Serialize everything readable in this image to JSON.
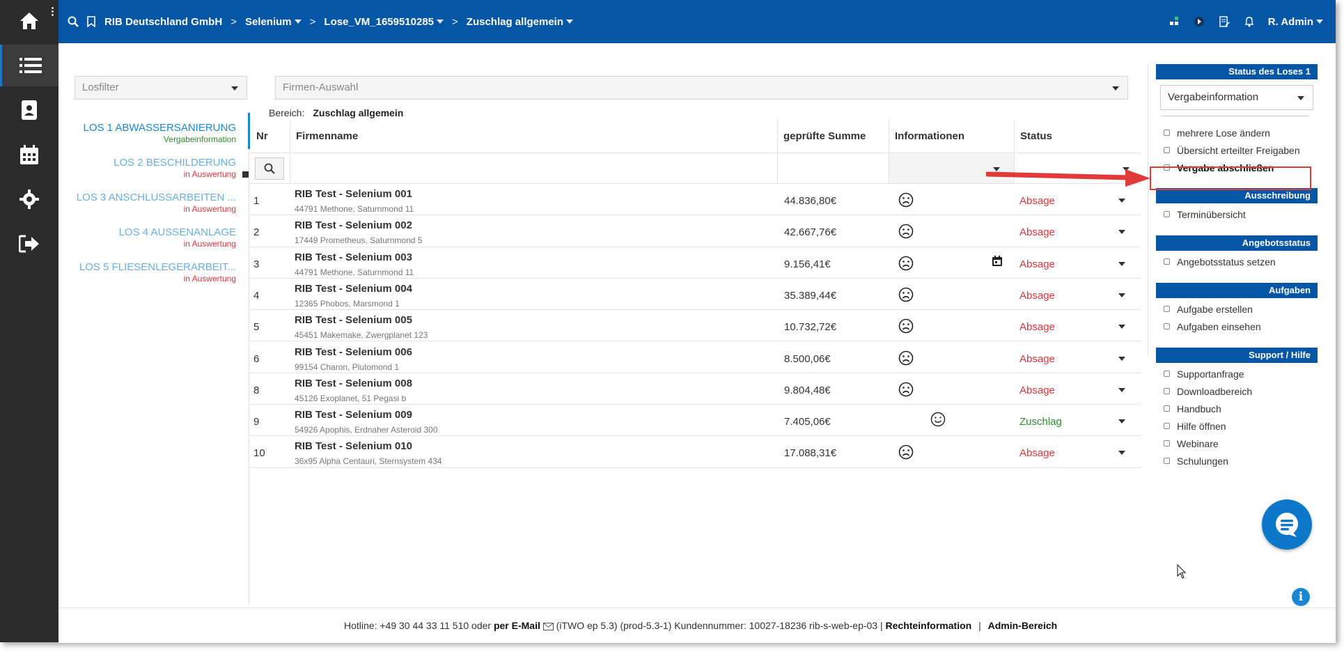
{
  "topbar": {
    "breadcrumbs": [
      {
        "label": "RIB Deutschland GmbH",
        "dropdown": false
      },
      {
        "label": "Selenium",
        "dropdown": true
      },
      {
        "label": "Lose_VM_1659510285",
        "dropdown": true
      },
      {
        "label": "Zuschlag allgemein",
        "dropdown": true
      }
    ],
    "user": "R. Admin"
  },
  "filters": {
    "losfilter_placeholder": "Losfilter",
    "firmen_placeholder": "Firmen-Auswahl",
    "bereich_label": "Bereich:",
    "bereich_value": "Zuschlag allgemein"
  },
  "lose": [
    {
      "name": "LOS 1 ABWASSERSANIERUNG",
      "status": "Vergabeinformation",
      "status_color": "green",
      "active": true
    },
    {
      "name": "LOS 2 BESCHILDERUNG",
      "status": "in Auswertung",
      "status_color": "red",
      "active": false
    },
    {
      "name": "LOS 3 ANSCHLUSSARBEITEN ...",
      "status": "in Auswertung",
      "status_color": "red",
      "active": false
    },
    {
      "name": "LOS 4 AUSSENANLAGE",
      "status": "in Auswertung",
      "status_color": "red",
      "active": false
    },
    {
      "name": "LOS 5 FLIESENLEGERARBEIT...",
      "status": "in Auswertung",
      "status_color": "red",
      "active": false
    }
  ],
  "table": {
    "headers": {
      "nr": "Nr",
      "firma": "Firmenname",
      "summe": "geprüfte Summe",
      "info": "Informationen",
      "status": "Status"
    },
    "rows": [
      {
        "nr": "1",
        "firma": "RIB Test - Selenium 001",
        "adresse": "44791 Methone, Saturnmond 11",
        "summe": "44.836,80€",
        "face": "sad",
        "calendar": false,
        "status": "Absage"
      },
      {
        "nr": "2",
        "firma": "RIB Test - Selenium 002",
        "adresse": "17449 Prometheus, Saturnmond 5",
        "summe": "42.667,76€",
        "face": "sad",
        "calendar": false,
        "status": "Absage"
      },
      {
        "nr": "3",
        "firma": "RIB Test - Selenium 003",
        "adresse": "44791 Methone, Saturnmond 11",
        "summe": "9.156,41€",
        "face": "sad",
        "calendar": true,
        "status": "Absage"
      },
      {
        "nr": "4",
        "firma": "RIB Test - Selenium 004",
        "adresse": "12365 Phobos, Marsmond 1",
        "summe": "35.389,44€",
        "face": "sad",
        "calendar": false,
        "status": "Absage"
      },
      {
        "nr": "5",
        "firma": "RIB Test - Selenium 005",
        "adresse": "45451 Makemake, Zwergplanet 123",
        "summe": "10.732,72€",
        "face": "sad",
        "calendar": false,
        "status": "Absage"
      },
      {
        "nr": "6",
        "firma": "RIB Test - Selenium 006",
        "adresse": "99154 Charon, Plutomond 1",
        "summe": "8.500,06€",
        "face": "sad",
        "calendar": false,
        "status": "Absage"
      },
      {
        "nr": "8",
        "firma": "RIB Test - Selenium 008",
        "adresse": "45126 Exoplanet, 51 Pegasi b",
        "summe": "9.804,48€",
        "face": "sad",
        "calendar": false,
        "status": "Absage"
      },
      {
        "nr": "9",
        "firma": "RIB Test - Selenium 009",
        "adresse": "54926 Apophis, Erdnaher Asteroid 300",
        "summe": "7.405,06€",
        "face": "happy",
        "calendar": false,
        "status": "Zuschlag"
      },
      {
        "nr": "10",
        "firma": "RIB Test - Selenium 010",
        "adresse": "36x95 Alpha Centauri, Sternsystem 434",
        "summe": "17.088,31€",
        "face": "sad",
        "calendar": false,
        "status": "Absage"
      }
    ]
  },
  "right_panel": {
    "status_header": "Status des Loses 1",
    "status_select": "Vergabeinformation",
    "status_links": [
      "mehrere Lose ändern",
      "Übersicht erteilter Freigaben",
      "Vergabe abschließen"
    ],
    "ausschreibung_header": "Ausschreibung",
    "ausschreibung_links": [
      "Terminübersicht"
    ],
    "angebotsstatus_header": "Angebotsstatus",
    "angebotsstatus_links": [
      "Angebotsstatus setzen"
    ],
    "aufgaben_header": "Aufgaben",
    "aufgaben_links": [
      "Aufgabe erstellen",
      "Aufgaben einsehen"
    ],
    "support_header": "Support / Hilfe",
    "support_links": [
      "Supportanfrage",
      "Downloadbereich",
      "Handbuch",
      "Hilfe öffnen",
      "Webinare",
      "Schulungen"
    ]
  },
  "footer": {
    "hotline": "Hotline: +49 30 44 33 11 510 oder",
    "email_link": "per E-Mail",
    "version": "(iTWO ep 5.3) (prod-5.3-1)   Kundennummer: 10027-18236 rib-s-web-ep-03 |",
    "recht_link": "Rechteinformation",
    "sep": "|",
    "admin_link": "Admin-Bereich"
  },
  "colors": {
    "topbar": "#0557a5",
    "sidebar": "#2b2b2b",
    "absage": "#d9363e",
    "zuschlag": "#2e8b2e",
    "link": "#1b87d2",
    "highlight": "#e03a3a"
  }
}
